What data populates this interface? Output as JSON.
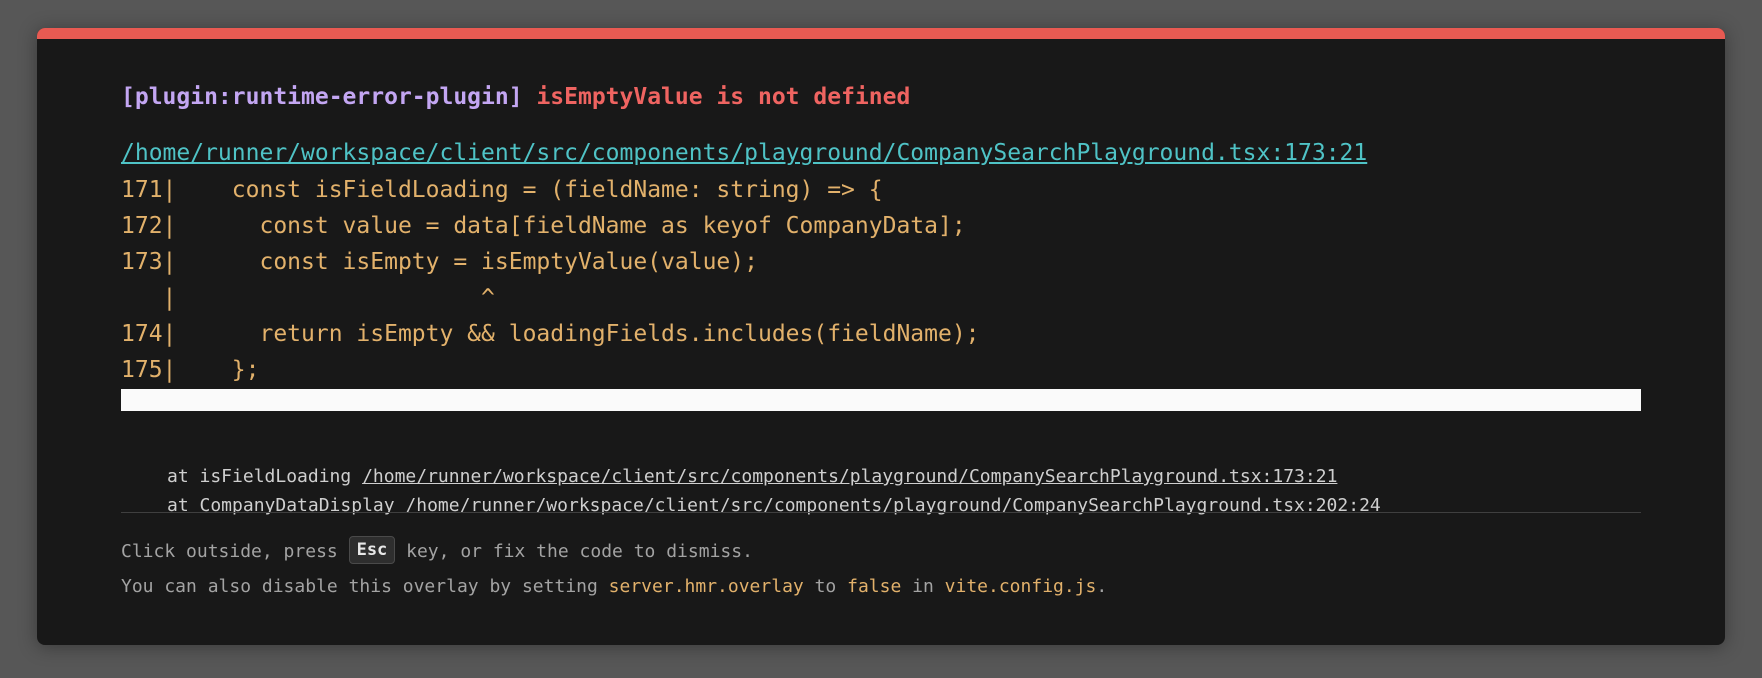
{
  "overlay": {
    "plugin_label": "[plugin:runtime-error-plugin]",
    "error_message": "isEmptyValue is not defined",
    "file_location": "/home/runner/workspace/client/src/components/playground/CompanySearchPlayground.tsx:173:21",
    "code_frame": [
      "171|    const isFieldLoading = (fieldName: string) => {",
      "172|      const value = data[fieldName as keyof CompanyData];",
      "173|      const isEmpty = isEmptyValue(value);",
      "   |                      ^",
      "174|      return isEmpty && loadingFields.includes(fieldName);",
      "175|    };"
    ],
    "stack": [
      {
        "prefix": "at isFieldLoading ",
        "location": "/home/runner/workspace/client/src/components/playground/CompanySearchPlayground.tsx:173:21"
      },
      {
        "prefix": "at CompanyDataDisplay ",
        "location": "/home/runner/workspace/client/src/components/playground/CompanySearchPlayground.tsx:202:24"
      }
    ],
    "tip": {
      "line1_before": "Click outside, press ",
      "esc_key": "Esc",
      "line1_after": " key, or fix the code to dismiss.",
      "line2_before": "You can also disable this overlay by setting ",
      "line2_setting": "server.hmr.overlay",
      "line2_mid1": " to ",
      "line2_value": "false",
      "line2_mid2": " in ",
      "line2_file": "vite.config.js",
      "line2_end": "."
    },
    "colors": {
      "accent_bar": "#e85a52",
      "plugin": "#c3a6f2",
      "error": "#ef6461",
      "link": "#4fc3c6",
      "code": "#e2b16b",
      "background": "#181818"
    }
  }
}
